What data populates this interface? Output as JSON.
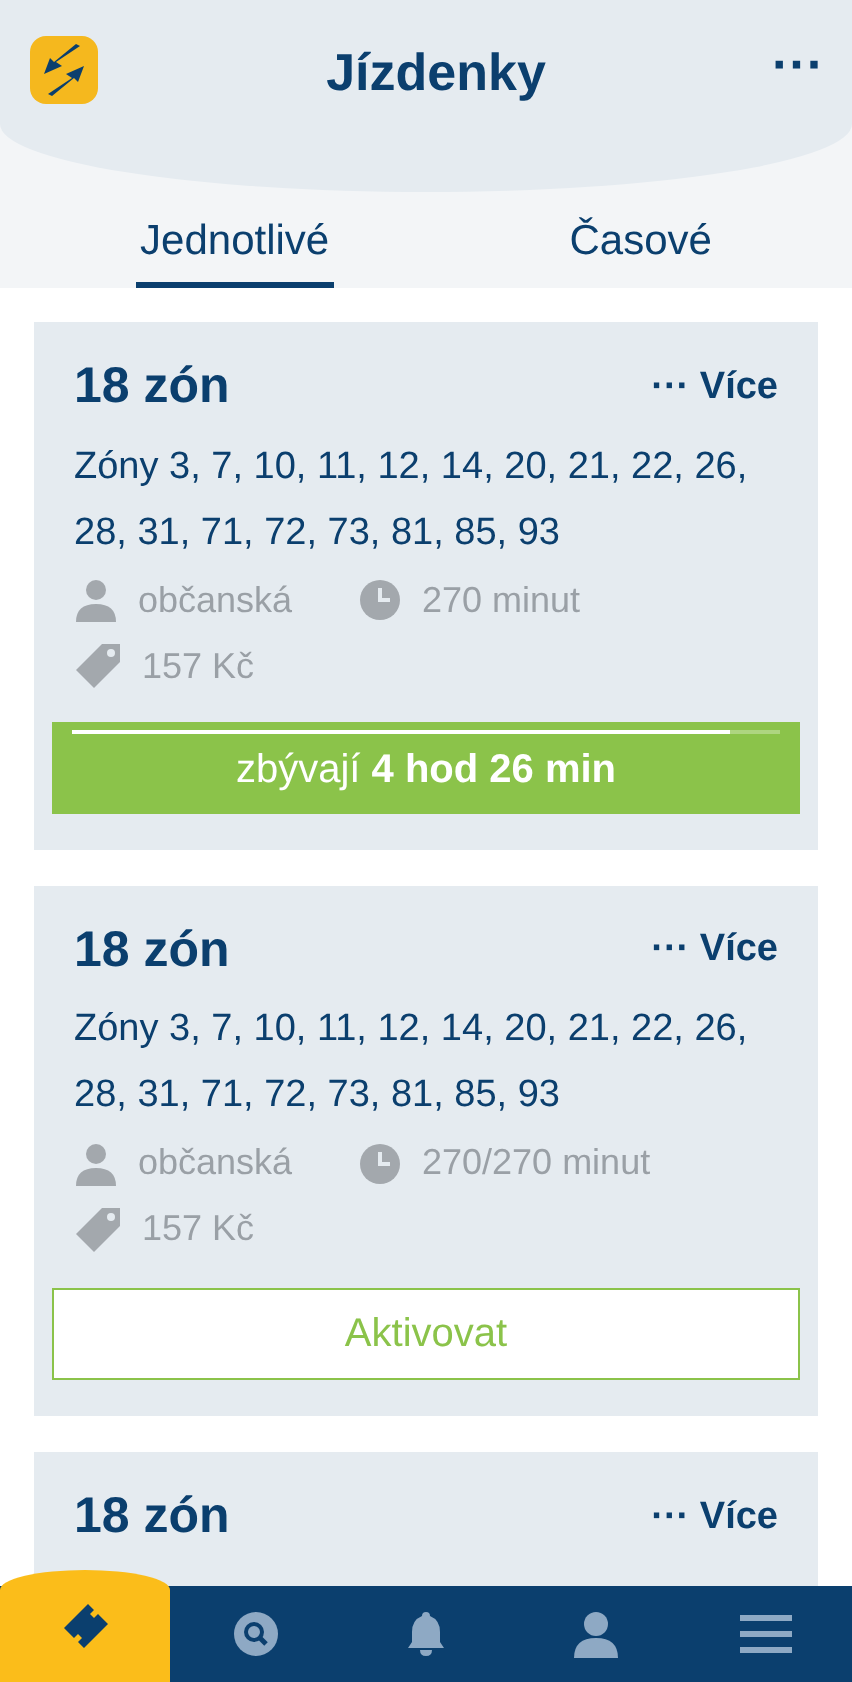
{
  "header": {
    "title": "Jízdenky",
    "menu": "···"
  },
  "tabs": [
    {
      "label": "Jednotlivé",
      "selected": true
    },
    {
      "label": "Časové",
      "selected": false
    }
  ],
  "tickets": [
    {
      "kind": "active",
      "title": "18 zón",
      "more": "··· Více",
      "zones": "Zóny 3, 7, 10, 11, 12, 14, 20, 21, 22, 26, 28, 31, 71, 72, 73, 81, 85, 93",
      "fare": "občanská",
      "duration": "270 minut",
      "price": "157 Kč",
      "remaining": "zbývají **4 hod 26 min**",
      "level": 0.93
    },
    {
      "kind": "inactive",
      "title": "18 zón",
      "more": "··· Více",
      "zones": "Zóny 3, 7, 10, 11, 12, 14, 20, 21, 22, 26, 28, 31, 71, 72, 73, 81, 85, 93",
      "fare": "občanská",
      "duration": "270/270 minut",
      "price": "157 Kč",
      "action": "Aktivovat"
    },
    {
      "kind": "partial",
      "title": "18 zón",
      "more": "··· Více"
    }
  ],
  "nav": [
    {
      "kind": "ticket",
      "selected": true
    },
    {
      "kind": "search",
      "selected": false
    },
    {
      "kind": "bell",
      "selected": false
    },
    {
      "kind": "person",
      "selected": false
    },
    {
      "kind": "menu",
      "selected": false
    }
  ]
}
